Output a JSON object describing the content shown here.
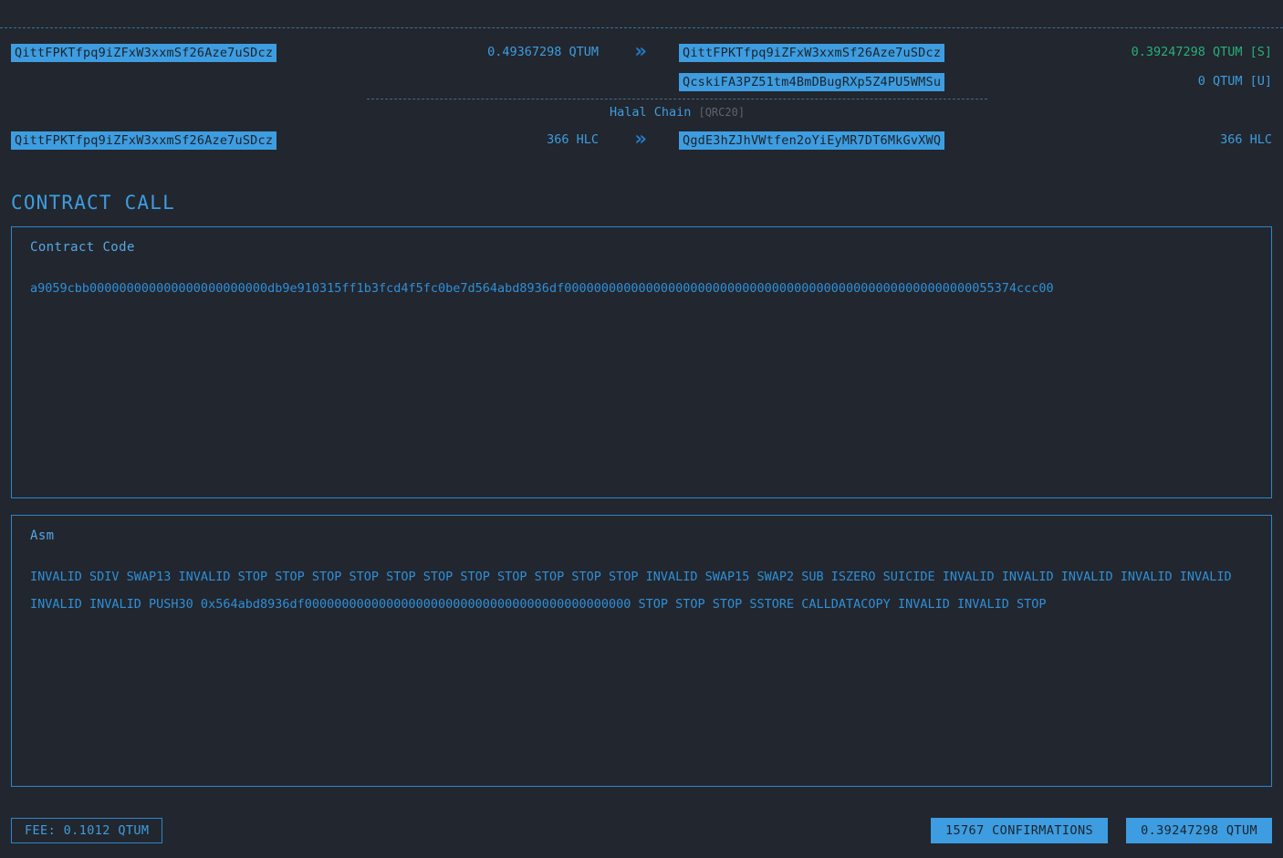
{
  "clipped_top_row": {
    "left_fragment": "",
    "center_fragment": "",
    "right_fragment": ""
  },
  "transfers": {
    "qtum": {
      "input_address": "QittFPKTfpq9iZFxW3xxmSf26Aze7uSDcz",
      "input_amount": "0.49367298 QTUM",
      "arrow_icon": "»",
      "outputs": [
        {
          "address": "QittFPKTfpq9iZFxW3xxmSf26Aze7uSDcz",
          "amount": "0.39247298 QTUM [S]",
          "spent": true
        },
        {
          "address": "QcskiFA3PZ51tm4BmDBugRXp5Z4PU5WMSu",
          "amount": "0 QTUM [U]",
          "spent": false
        }
      ]
    },
    "token": {
      "name": "Halal Chain",
      "standard": "[QRC20]",
      "input_address": "QittFPKTfpq9iZFxW3xxmSf26Aze7uSDcz",
      "input_amount": "366 HLC",
      "arrow_icon": "»",
      "output_address": "QgdE3hZJhVWtfen2oYiEyMR7DT6MkGvXWQ",
      "output_amount": "366 HLC"
    }
  },
  "contract_call": {
    "heading": "CONTRACT CALL",
    "code_panel": {
      "label": "Contract Code",
      "value": "a9059cbb000000000000000000000000db9e910315ff1b3fcd4f5fc0be7d564abd8936df0000000000000000000000000000000000000000000000000000000055374ccc00"
    },
    "asm_panel": {
      "label": "Asm",
      "value": "INVALID SDIV SWAP13 INVALID STOP STOP STOP STOP STOP STOP STOP STOP STOP STOP STOP INVALID SWAP15 SWAP2 SUB ISZERO SUICIDE INVALID INVALID INVALID INVALID INVALID INVALID INVALID PUSH30 0x564abd8936df00000000000000000000000000000000000000000000 STOP STOP STOP SSTORE CALLDATACOPY INVALID INVALID STOP"
    }
  },
  "footer": {
    "fee": "FEE: 0.1012 QTUM",
    "confirmations": "15767 CONFIRMATIONS",
    "value": "0.39247298 QTUM"
  },
  "colors": {
    "background": "#22262e",
    "accent": "#3d9de0",
    "accent_dark": "#2f8fd8",
    "green": "#26b07a",
    "muted": "#5c6470",
    "border": "#2f86c9"
  }
}
